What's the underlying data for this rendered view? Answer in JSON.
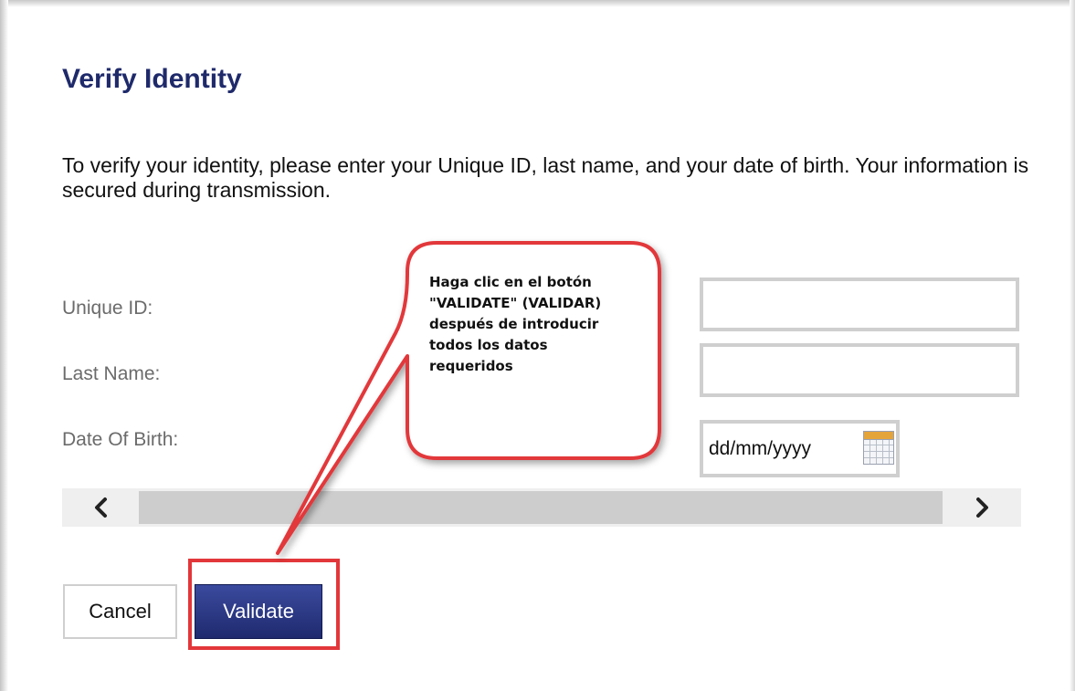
{
  "page": {
    "title": "Verify Identity",
    "intro": "To verify your identity, please enter your Unique ID, last name, and your date of birth. Your information is secured during transmission."
  },
  "form": {
    "unique_id_label": "Unique ID:",
    "unique_id_value": "",
    "last_name_label": "Last Name:",
    "last_name_value": "",
    "dob_label": "Date Of Birth:",
    "dob_placeholder": "dd/mm/yyyy"
  },
  "scrollbar": {
    "left_arrow": "❮",
    "right_arrow": "❯"
  },
  "buttons": {
    "cancel_label": "Cancel",
    "validate_label": "Validate"
  },
  "callout": {
    "text": "Haga clic en el botón \"VALIDATE\" (VALIDAR) después de introducir todos los datos requeridos"
  },
  "icons": {
    "calendar": "calendar-icon",
    "scroll_left": "chevron-left-icon",
    "scroll_right": "chevron-right-icon"
  },
  "colors": {
    "title": "#1f2a6b",
    "validate_button": "#2a3585",
    "annotation_red": "#e2373a",
    "field_border": "#cfcfcf"
  }
}
